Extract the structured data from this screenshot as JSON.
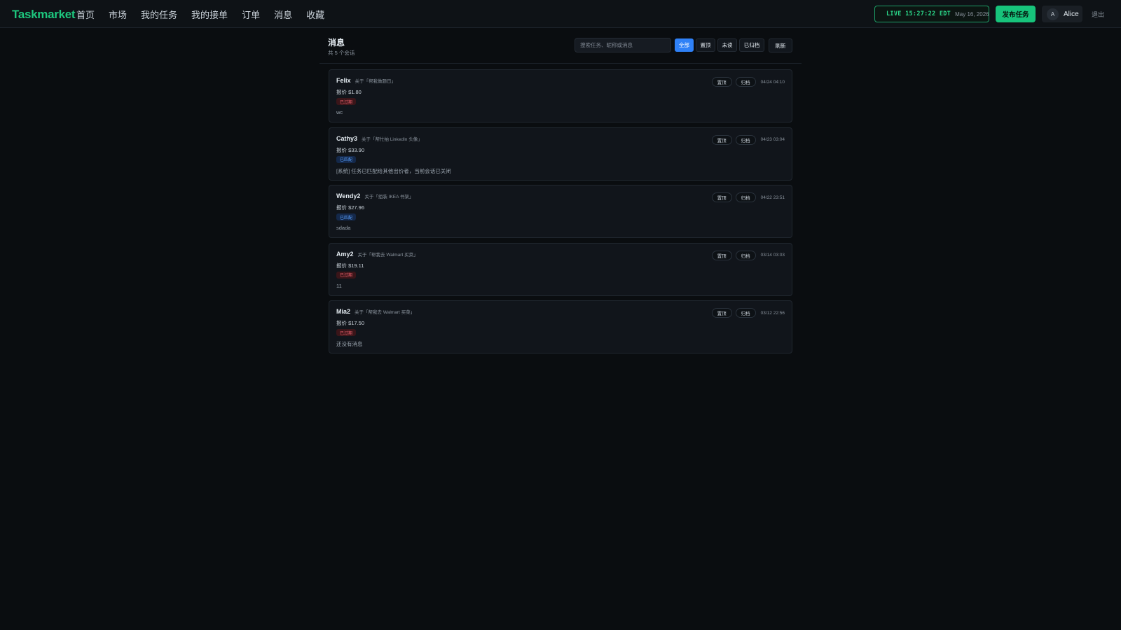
{
  "app": {
    "logo": "Taskmarket"
  },
  "nav": [
    "首页",
    "市场",
    "我的任务",
    "我的接单",
    "订单",
    "消息",
    "收藏"
  ],
  "header": {
    "live_time": "LIVE 15:27:22 EDT",
    "live_date": "May 16, 2026",
    "publish_label": "发布任务",
    "avatar_initial": "A",
    "username": "Alice",
    "logout_label": "退出"
  },
  "page": {
    "title": "消息",
    "count_text": "共 5 个会话",
    "search_placeholder": "搜索任务、昵称或消息",
    "filters": [
      "全部",
      "置顶",
      "未读",
      "已归档"
    ],
    "active_filter": "全部",
    "refresh_label": "刷新"
  },
  "conversations": [
    {
      "name": "Felix",
      "about": "关于「帮我做题日」",
      "price": "报价 $1.80",
      "status": "已过期",
      "status_type": "expired",
      "last_message": "wc",
      "pin_label": "置顶",
      "archive_label": "归档",
      "time": "04/24 04:10"
    },
    {
      "name": "Cathy3",
      "about": "关于「帮忙拍 LinkedIn 头像」",
      "price": "报价 $33.90",
      "status": "已匹配",
      "status_type": "matched",
      "last_message": "[系统] 任务已匹配给其他出价者，当前会话已关闭",
      "pin_label": "置顶",
      "archive_label": "归档",
      "time": "04/23 03:04"
    },
    {
      "name": "Wendy2",
      "about": "关于「组装 IKEA 书架」",
      "price": "报价 $27.96",
      "status": "已匹配",
      "status_type": "matched",
      "last_message": "sdada",
      "pin_label": "置顶",
      "archive_label": "归档",
      "time": "04/22 23:51"
    },
    {
      "name": "Amy2",
      "about": "关于「帮我去 Walmart 买菜」",
      "price": "报价 $19.11",
      "status": "已过期",
      "status_type": "expired",
      "last_message": "11",
      "pin_label": "置顶",
      "archive_label": "归档",
      "time": "03/14 03:03"
    },
    {
      "name": "Mia2",
      "about": "关于「帮我去 Walmart 买菜」",
      "price": "报价 $17.50",
      "status": "已过期",
      "status_type": "expired",
      "last_message": "还没有消息",
      "pin_label": "置顶",
      "archive_label": "归档",
      "time": "03/12 22:56"
    }
  ]
}
